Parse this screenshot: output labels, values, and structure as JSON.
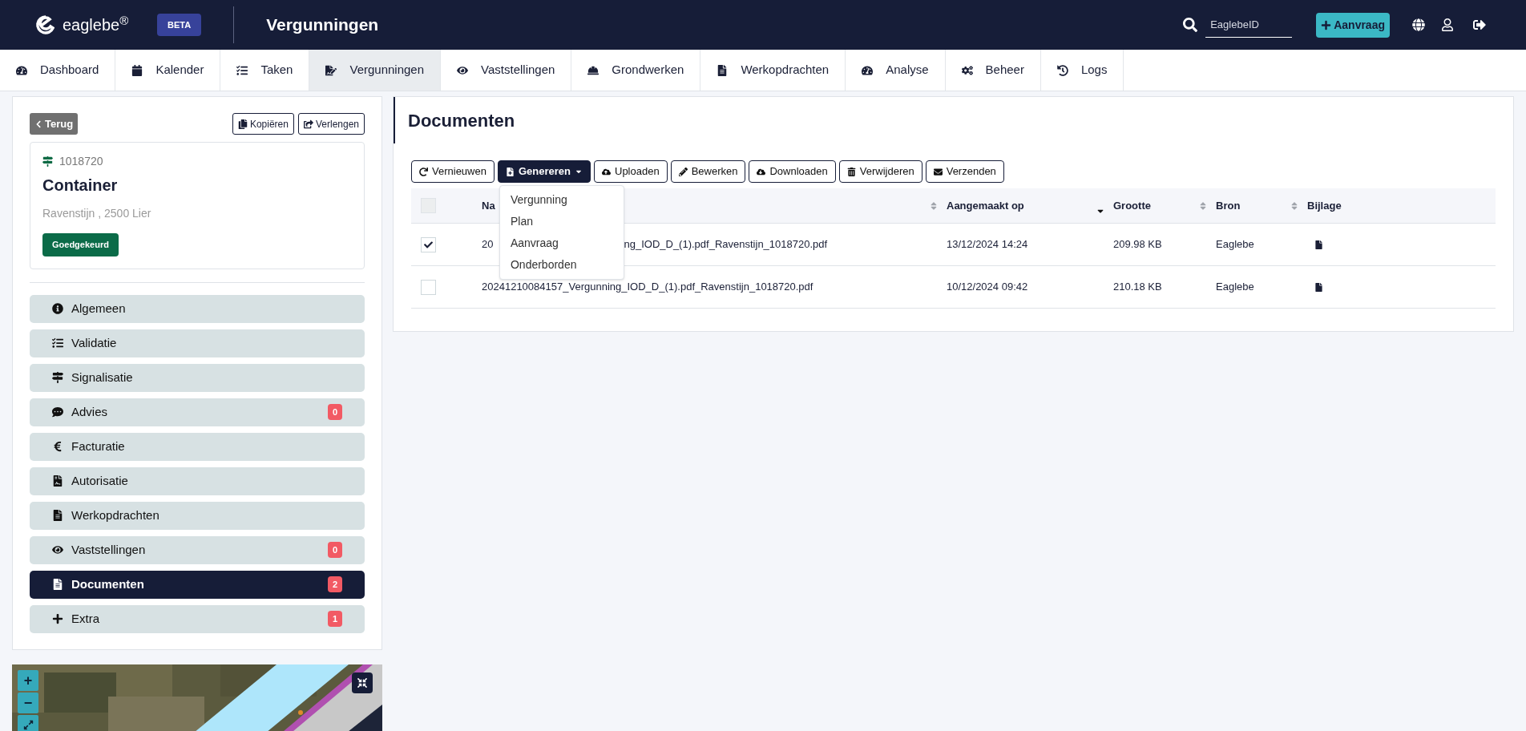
{
  "header": {
    "logo": "eaglebe$^{®}$",
    "badge": "BETA",
    "title": "Vergunningen",
    "search": {
      "placeholder": "EaglebeID"
    },
    "new_button": "Aanvraag"
  },
  "nav": [
    {
      "label": "Dashboard",
      "selected": false
    },
    {
      "label": "Kalender",
      "selected": false
    },
    {
      "label": "Taken",
      "selected": false
    },
    {
      "label": "Vergunningen",
      "selected": true
    },
    {
      "label": "Vaststellingen",
      "selected": false
    },
    {
      "label": "Grondwerken",
      "selected": false
    },
    {
      "label": "Werkopdrachten",
      "selected": false
    },
    {
      "label": "Analyse",
      "selected": false
    },
    {
      "label": "Beheer",
      "selected": false
    },
    {
      "label": "Logs",
      "selected": false
    }
  ],
  "sidebar": {
    "back": "Terug",
    "actions": [
      "Kopiëren",
      "Verlengen"
    ],
    "permit": {
      "number": "1018720",
      "type": "Container",
      "address": "Ravenstijn , 2500 Lier",
      "status": "Goedgekeurd"
    },
    "items": [
      {
        "label": "Algemeen",
        "selected": false
      },
      {
        "label": "Validatie",
        "selected": false
      },
      {
        "label": "Signalisatie",
        "selected": false
      },
      {
        "label": "Advies",
        "selected": false,
        "badge": "0"
      },
      {
        "label": "Facturatie",
        "selected": false
      },
      {
        "label": "Autorisatie",
        "selected": false
      },
      {
        "label": "Werkopdrachten",
        "selected": false
      },
      {
        "label": "Vaststellingen",
        "selected": false,
        "badge": "0"
      },
      {
        "label": "Documenten",
        "selected": true,
        "badge": "2"
      },
      {
        "label": "Extra",
        "selected": false,
        "badge": "1"
      }
    ]
  },
  "map": {
    "controls": [
      "+",
      "−"
    ]
  },
  "documents": {
    "title": "Documenten",
    "toolbar": [
      {
        "label": "Vernieuwen",
        "kind": "button",
        "expanded": false
      },
      {
        "label": "Genereren",
        "kind": "dropdown",
        "expanded": true
      },
      {
        "label": "Uploaden",
        "kind": "button",
        "expanded": false
      },
      {
        "label": "Bewerken",
        "kind": "button",
        "expanded": false
      },
      {
        "label": "Downloaden",
        "kind": "button",
        "expanded": false
      },
      {
        "label": "Verwijderen",
        "kind": "button",
        "expanded": false
      },
      {
        "label": "Verzenden",
        "kind": "button",
        "expanded": false
      }
    ],
    "menu": [
      "Vergunning",
      "Plan",
      "Aanvraag",
      "Onderborden"
    ],
    "select_all": {
      "checked": false
    },
    "columns": [
      {
        "label": "Na",
        "kind": "sortable",
        "sorted": false
      },
      {
        "label": "Aangemaakt op",
        "kind": "sortable",
        "sorted": true
      },
      {
        "label": "Grootte",
        "kind": "sortable",
        "sorted": false
      },
      {
        "label": "Bron",
        "kind": "sortable",
        "sorted": false
      },
      {
        "label": "Bijlage",
        "kind": "plain"
      }
    ],
    "rows": [
      {
        "checked": true,
        "name": [
          "20",
          "ng_IOD_D_(1).pdf_Ravenstijn_1018720.pdf"
        ],
        "created": "13/12/2024 14:24",
        "size": "209.98 KB",
        "source": "Eaglebe"
      },
      {
        "checked": false,
        "name": [
          "20241210084157_Vergunning_IOD_D_(1).pdf_Ravenstijn_1018720.pdf"
        ],
        "created": "10/12/2024 09:42",
        "size": "210.18 KB",
        "source": "Eaglebe"
      }
    ]
  }
}
